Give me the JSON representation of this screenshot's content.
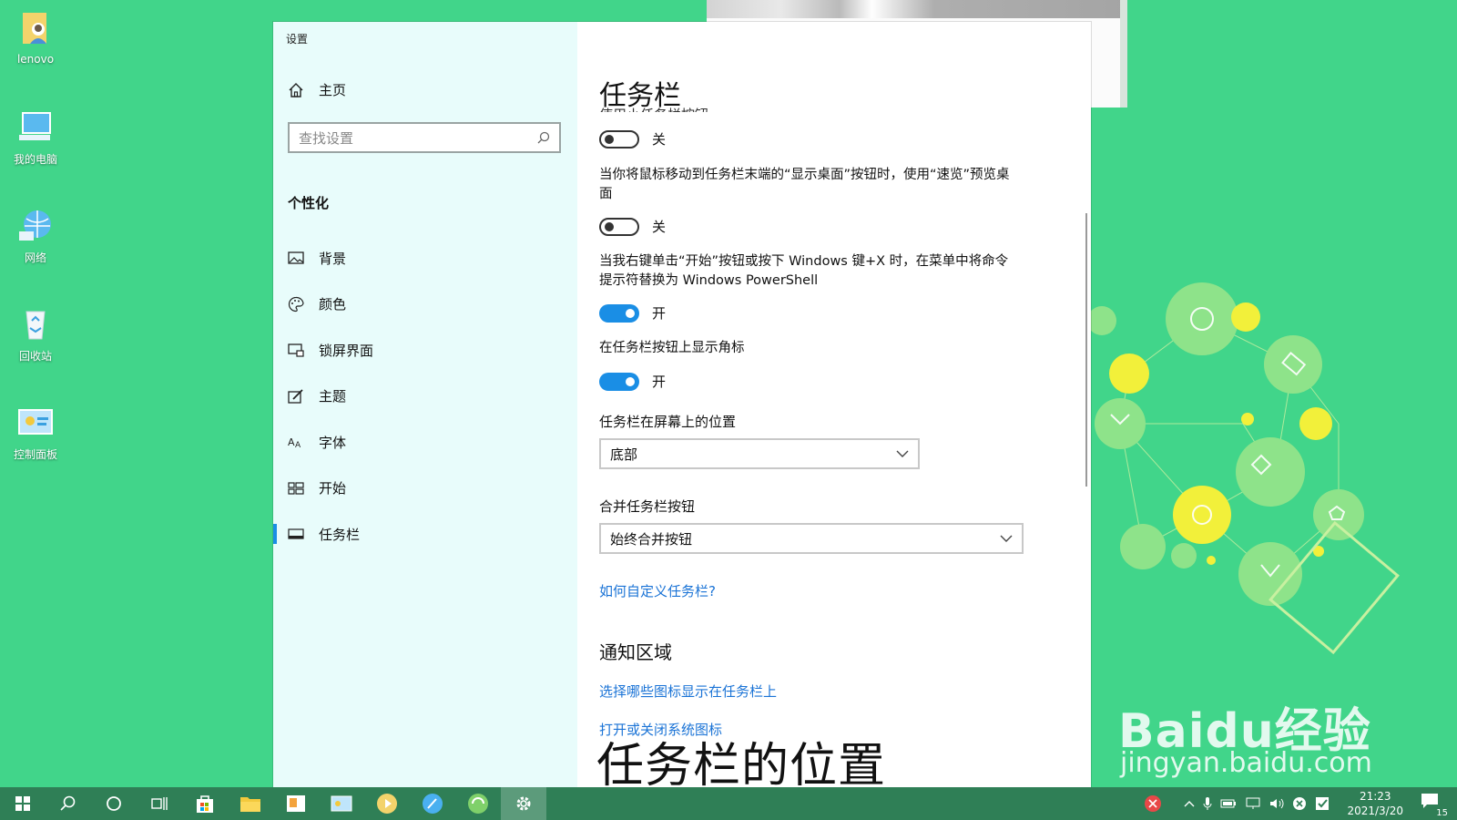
{
  "desktop": {
    "icons": [
      {
        "label": "lenovo",
        "icon": "user-folder-icon"
      },
      {
        "label": "我的电脑",
        "icon": "computer-icon"
      },
      {
        "label": "网络",
        "icon": "network-icon"
      },
      {
        "label": "回收站",
        "icon": "recycle-bin-icon"
      },
      {
        "label": "控制面板",
        "icon": "control-panel-icon"
      }
    ]
  },
  "window": {
    "title": "设置"
  },
  "sidebar": {
    "home_label": "主页",
    "search_placeholder": "查找设置",
    "section_title": "个性化",
    "items": [
      {
        "label": "背景",
        "icon": "picture-icon"
      },
      {
        "label": "颜色",
        "icon": "palette-icon"
      },
      {
        "label": "锁屏界面",
        "icon": "lock-screen-icon"
      },
      {
        "label": "主题",
        "icon": "theme-brush-icon"
      },
      {
        "label": "字体",
        "icon": "font-icon"
      },
      {
        "label": "开始",
        "icon": "start-grid-icon"
      },
      {
        "label": "任务栏",
        "icon": "taskbar-icon",
        "active": true
      }
    ]
  },
  "content": {
    "page_title": "任务栏",
    "cut_label": "使用小任务栏按钮",
    "toggle_1": {
      "state": "关",
      "on": false
    },
    "setting_2": {
      "desc": "当你将鼠标移动到任务栏末端的“显示桌面”按钮时，使用“速览”预览桌面",
      "state": "关",
      "on": false
    },
    "setting_3": {
      "desc": "当我右键单击“开始”按钮或按下 Windows 键+X 时，在菜单中将命令提示符替换为 Windows PowerShell",
      "state": "开",
      "on": true
    },
    "setting_4": {
      "desc": "在任务栏按钮上显示角标",
      "state": "开",
      "on": true
    },
    "position": {
      "label": "任务栏在屏幕上的位置",
      "value": "底部"
    },
    "combine": {
      "label": "合并任务栏按钮",
      "value": "始终合并按钮"
    },
    "help_link": "如何自定义任务栏?",
    "notify_heading": "通知区域",
    "notify_link_1": "选择哪些图标显示在任务栏上",
    "notify_link_2": "打开或关闭系统图标"
  },
  "overlay": {
    "caption": "任务栏的位置",
    "watermark_logo": "Baidu经验",
    "watermark_url": "jingyan.baidu.com"
  },
  "taskbar": {
    "clock_time": "21:23",
    "clock_date": "2021/3/20",
    "notification_count": "15",
    "colors": {
      "bg": "#2f7f56",
      "accent": "#1a8ee5"
    }
  }
}
